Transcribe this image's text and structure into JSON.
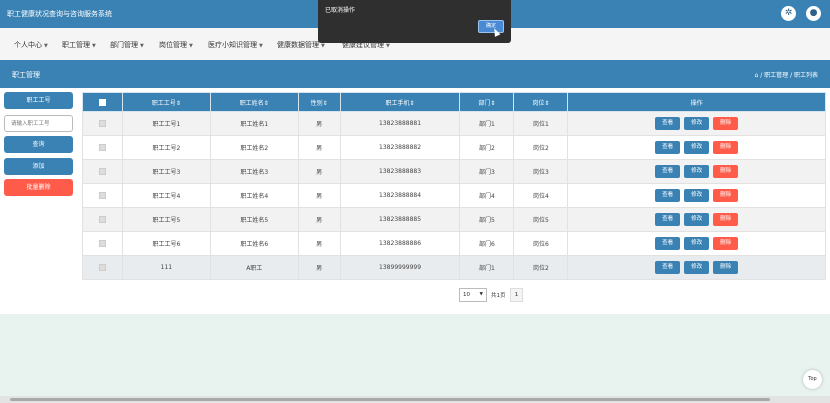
{
  "app": {
    "title": "职工健康状况查询与咨询服务系统"
  },
  "header_icons": [
    "settings-gear-icon",
    "user-avatar-icon"
  ],
  "nav": {
    "items": [
      "个人中心",
      "职工管理",
      "部门管理",
      "岗位管理",
      "医疗小知识管理",
      "健康数据管理",
      "健康建议管理"
    ]
  },
  "breadcrumb": {
    "page_title": "职工管理",
    "path": "⌂ / 职工管理 / 职工列表"
  },
  "sidebar": {
    "tag_label": "职工工号",
    "search_placeholder": "请输入职工工号",
    "search_button": "查询",
    "add_button": "添加",
    "batch_delete_button": "批量删除"
  },
  "table": {
    "headers": [
      "职工工号⇕",
      "职工姓名⇕",
      "性别⇕",
      "职工手机⇕",
      "部门⇕",
      "岗位⇕",
      "操作"
    ],
    "actions": {
      "view": "查看",
      "edit": "修改",
      "delete": "删除"
    },
    "rows": [
      [
        "职工工号1",
        "职工姓名1",
        "男",
        "13823888881",
        "部门1",
        "岗位1"
      ],
      [
        "职工工号2",
        "职工姓名2",
        "男",
        "13823888882",
        "部门2",
        "岗位2"
      ],
      [
        "职工工号3",
        "职工姓名3",
        "男",
        "13823888883",
        "部门3",
        "岗位3"
      ],
      [
        "职工工号4",
        "职工姓名4",
        "男",
        "13823888884",
        "部门4",
        "岗位4"
      ],
      [
        "职工工号5",
        "职工姓名5",
        "男",
        "13823888885",
        "部门5",
        "岗位5"
      ],
      [
        "职工工号6",
        "职工姓名6",
        "男",
        "13823888886",
        "部门6",
        "岗位6"
      ],
      [
        "111",
        "A职工",
        "男",
        "13899999999",
        "部门1",
        "岗位2"
      ]
    ]
  },
  "pagination": {
    "page_size": "10",
    "total_label": "共1页",
    "current_page": "1"
  },
  "back_to_top": "Top",
  "dialog": {
    "message": "已取消操作",
    "ok_label": "确定"
  },
  "colors": {
    "primary": "#3a82b4",
    "danger": "#ff5b4a",
    "background": "#e8f2ef"
  }
}
